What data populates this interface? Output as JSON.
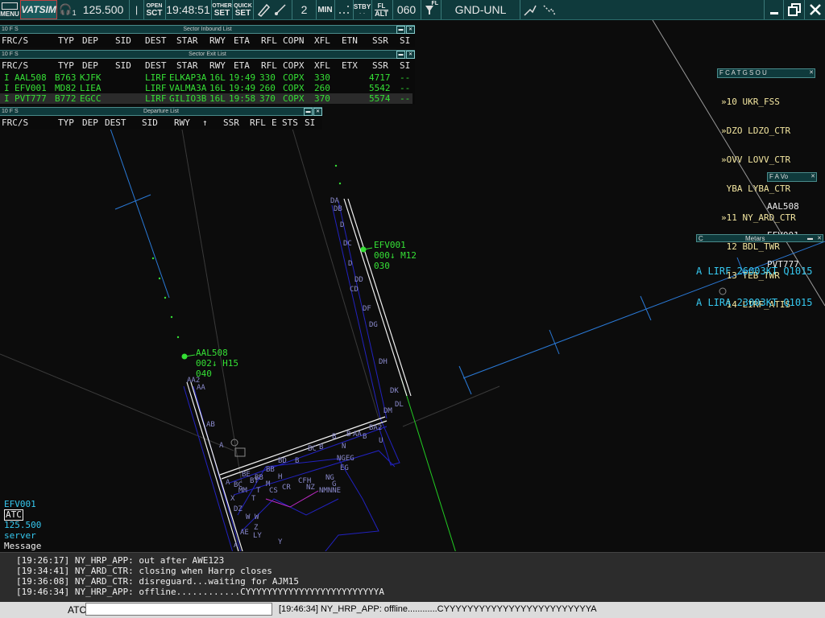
{
  "toolbar": {
    "menu_label": "MENU",
    "logo": "VATSIM",
    "headset_index": "1",
    "frequency": "125.500",
    "open_top": "OPEN",
    "open_bottom": "SCT",
    "clock": "19:48:51",
    "other_top": "OTHER",
    "other_bottom": "SET",
    "quick_top": "QUICK",
    "quick_bottom": "SET",
    "range_value": "2",
    "min_label": "MIN",
    "stby_label": "STBY",
    "fl_top": "FL",
    "fl_bottom": "ALT",
    "altitude": "060",
    "filter_label": "FL",
    "station": "GND-UNL"
  },
  "inbound_list": {
    "flags": "10  F  S",
    "title": "Sector Inbound List",
    "columns": [
      "FRC/S",
      "TYP",
      "DEP",
      "SID",
      "DEST",
      "STAR",
      "RWY",
      "ETA",
      "RFL",
      "COPN",
      "XFL",
      "ETN",
      "SSR",
      "SI"
    ]
  },
  "exit_list": {
    "flags": "10  F  S",
    "title": "Sector Exit List",
    "columns": [
      "FRC/S",
      "TYP",
      "DEP",
      "SID",
      "DEST",
      "STAR",
      "RWY",
      "ETA",
      "RFL",
      "COPX",
      "XFL",
      "ETX",
      "SSR",
      "SI"
    ],
    "rows": [
      {
        "frc": "I",
        "cs": "AAL508",
        "typ": "B763",
        "dep": "KJFK",
        "dest": "LIRF",
        "star": "ELKAP3A",
        "rwy": "16L",
        "eta": "19:49",
        "rfl": "330",
        "copx": "COPX",
        "xfl": "330",
        "ssr": "4717",
        "si": "--"
      },
      {
        "frc": "I",
        "cs": "EFV001",
        "typ": "MD82",
        "dep": "LIEA",
        "dest": "LIRF",
        "star": "VALMA3A",
        "rwy": "16L",
        "eta": "19:49",
        "rfl": "260",
        "copx": "COPX",
        "xfl": "260",
        "ssr": "5542",
        "si": "--"
      },
      {
        "frc": "I",
        "cs": "PVT777",
        "typ": "B772",
        "dep": "EGCC",
        "dest": "LIRF",
        "star": "GILIO3B",
        "rwy": "16L",
        "eta": "19:58",
        "rfl": "370",
        "copx": "COPX",
        "xfl": "370",
        "ssr": "5574",
        "si": "--"
      }
    ]
  },
  "departure_list": {
    "flags": "10  F  S",
    "title": "Departure List",
    "columns": [
      "FRC/S",
      "TYP",
      "DEP",
      "DEST",
      "SID",
      "RWY",
      "↑",
      "SSR",
      "RFL",
      "E",
      "STS",
      "SI"
    ]
  },
  "controllers": {
    "header": "F C A T G S O U",
    "items": [
      "»10 UKR_FSS",
      "»DZO LDZO_CTR",
      "»OVV LOVV_CTR",
      " YBA LYBA_CTR",
      "»11 NY_ARD_CTR",
      " 12 BDL_TWR",
      " 13 TEB_TWR",
      " 14 LIRF_ATIS"
    ]
  },
  "aircraft_list": {
    "header": "F A Vo",
    "items": [
      "AAL508",
      "EFV001",
      "PVT777"
    ]
  },
  "metars": {
    "flag": "C",
    "title": "Metars",
    "items": [
      "A LIRF 26003KT Q1015",
      "A LIRA 23003KT Q1015"
    ]
  },
  "targets": [
    {
      "callsign": "EFV001",
      "line2": "000↓ M12",
      "line3": "030"
    },
    {
      "callsign": "AAL508",
      "line2": "002↓ H15",
      "line3": "040"
    }
  ],
  "left_info": {
    "callsign": "EFV001",
    "mode": "ATC",
    "frequency": "125.500",
    "type": "server",
    "label": "Message"
  },
  "messages": [
    "[19:26:17] NY_HRP_APP: out after AWE123",
    "[19:34:41] NY_ARD_CTR: closing when Harrp closes",
    "[19:36:08] NY_ARD_CTR: disreguard...waiting for AJM15",
    "[19:46:34] NY_HRP_APP: offline............CYYYYYYYYYYYYYYYYYYYYYYYYYA"
  ],
  "command_bar": {
    "label": "ATC",
    "input_value": "",
    "last_message": "[19:46:34] NY_HRP_APP: offline............CYYYYYYYYYYYYYYYYYYYYYYYYYA"
  },
  "colors": {
    "toolbar_bg": "#0f3a3c",
    "target_green": "#35e035",
    "controllers_yellow": "#f3e6a0",
    "metar_cyan": "#35c8f0",
    "runway_blue": "#2a2ac8"
  }
}
